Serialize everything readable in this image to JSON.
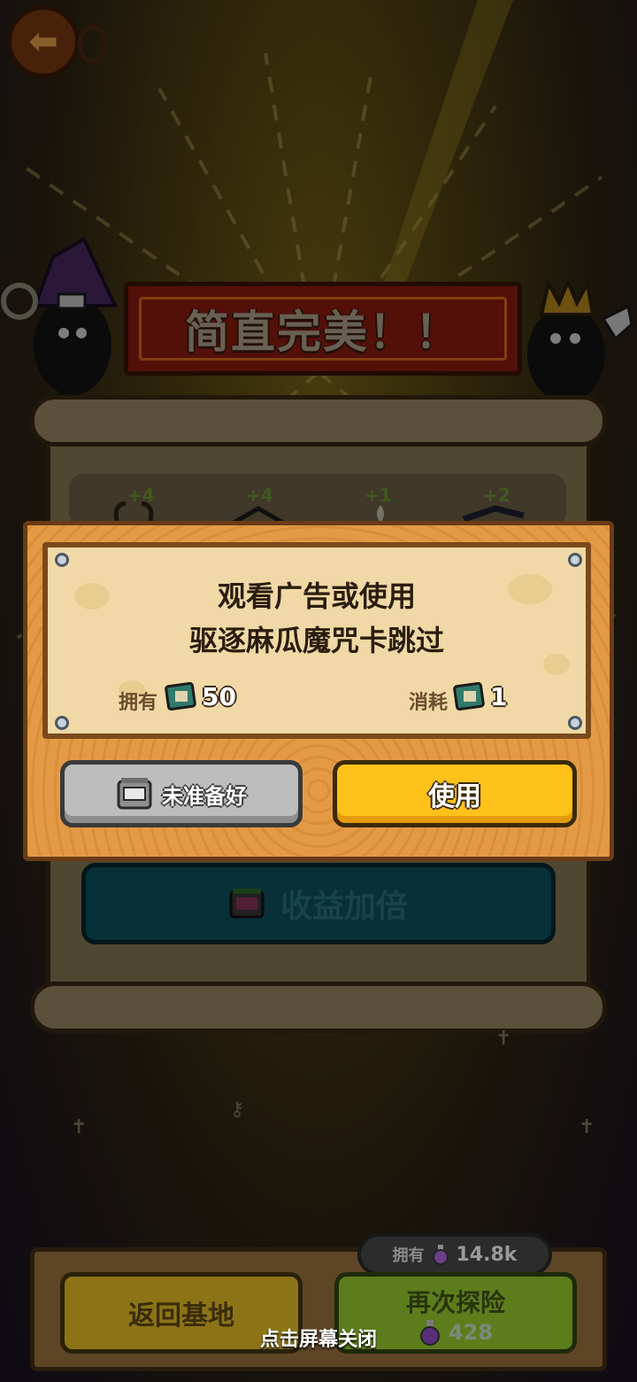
{
  "banner": {
    "title": "简直完美！！"
  },
  "rewards": [
    {
      "bonus": "+4",
      "icon": "horns-icon"
    },
    {
      "bonus": "+4",
      "icon": "bat-icon"
    },
    {
      "bonus": "+1",
      "icon": "flame-icon"
    },
    {
      "bonus": "+2",
      "icon": "lizard-icon"
    }
  ],
  "dialog": {
    "line1": "观看广告或使用",
    "line2": "驱逐麻瓜魔咒卡跳过",
    "own_label": "拥有",
    "own_count": "50",
    "cost_label": "消耗",
    "cost_count": "1",
    "not_ready_label": "未准备好",
    "use_label": "使用"
  },
  "double_button": {
    "label": "收益加倍"
  },
  "bottom": {
    "own_label": "拥有",
    "potion_count": "14.8k",
    "return_label": "返回基地",
    "explore_label": "再次探险",
    "explore_cost": "428",
    "close_hint": "点击屏幕关闭"
  },
  "colors": {
    "use_button": "#ffc21a",
    "banner_red": "#8e1c10",
    "dialog_wood": "#e49a45",
    "dialog_card": "#f0d9a6"
  }
}
